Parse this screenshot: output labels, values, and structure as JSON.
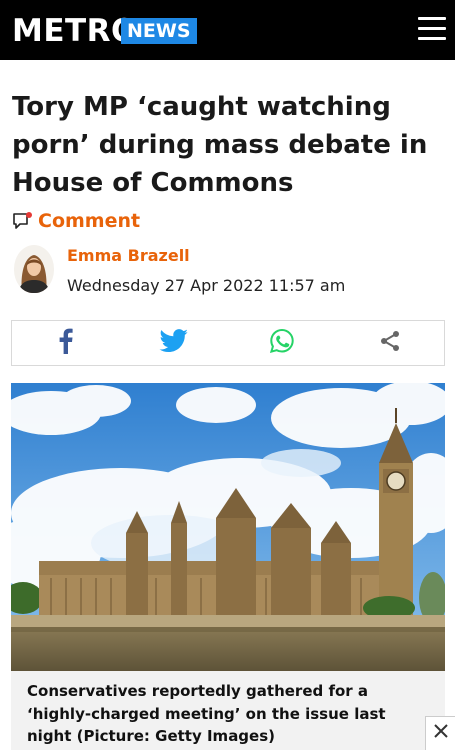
{
  "header": {
    "logo": "METRO",
    "section": "NEWS",
    "menu_icon": "hamburger-menu-icon",
    "background": "#000000",
    "section_color": "#1e88e5"
  },
  "article": {
    "headline": "Tory MP ‘caught watching porn’ during mass debate in House of Commons",
    "comment_label": "Comment",
    "accent_color": "#e8630a",
    "author": "Emma Brazell",
    "date": "Wednesday 27 Apr 2022 11:57 am"
  },
  "share": {
    "buttons": [
      "facebook-icon",
      "twitter-icon",
      "whatsapp-icon",
      "share-icon"
    ]
  },
  "hero": {
    "caption": "Conservatives reportedly gathered for a ‘highly-charged meeting’ on the issue last night (Picture: Getty Images)"
  },
  "ad": {
    "close_icon": "close-icon"
  }
}
